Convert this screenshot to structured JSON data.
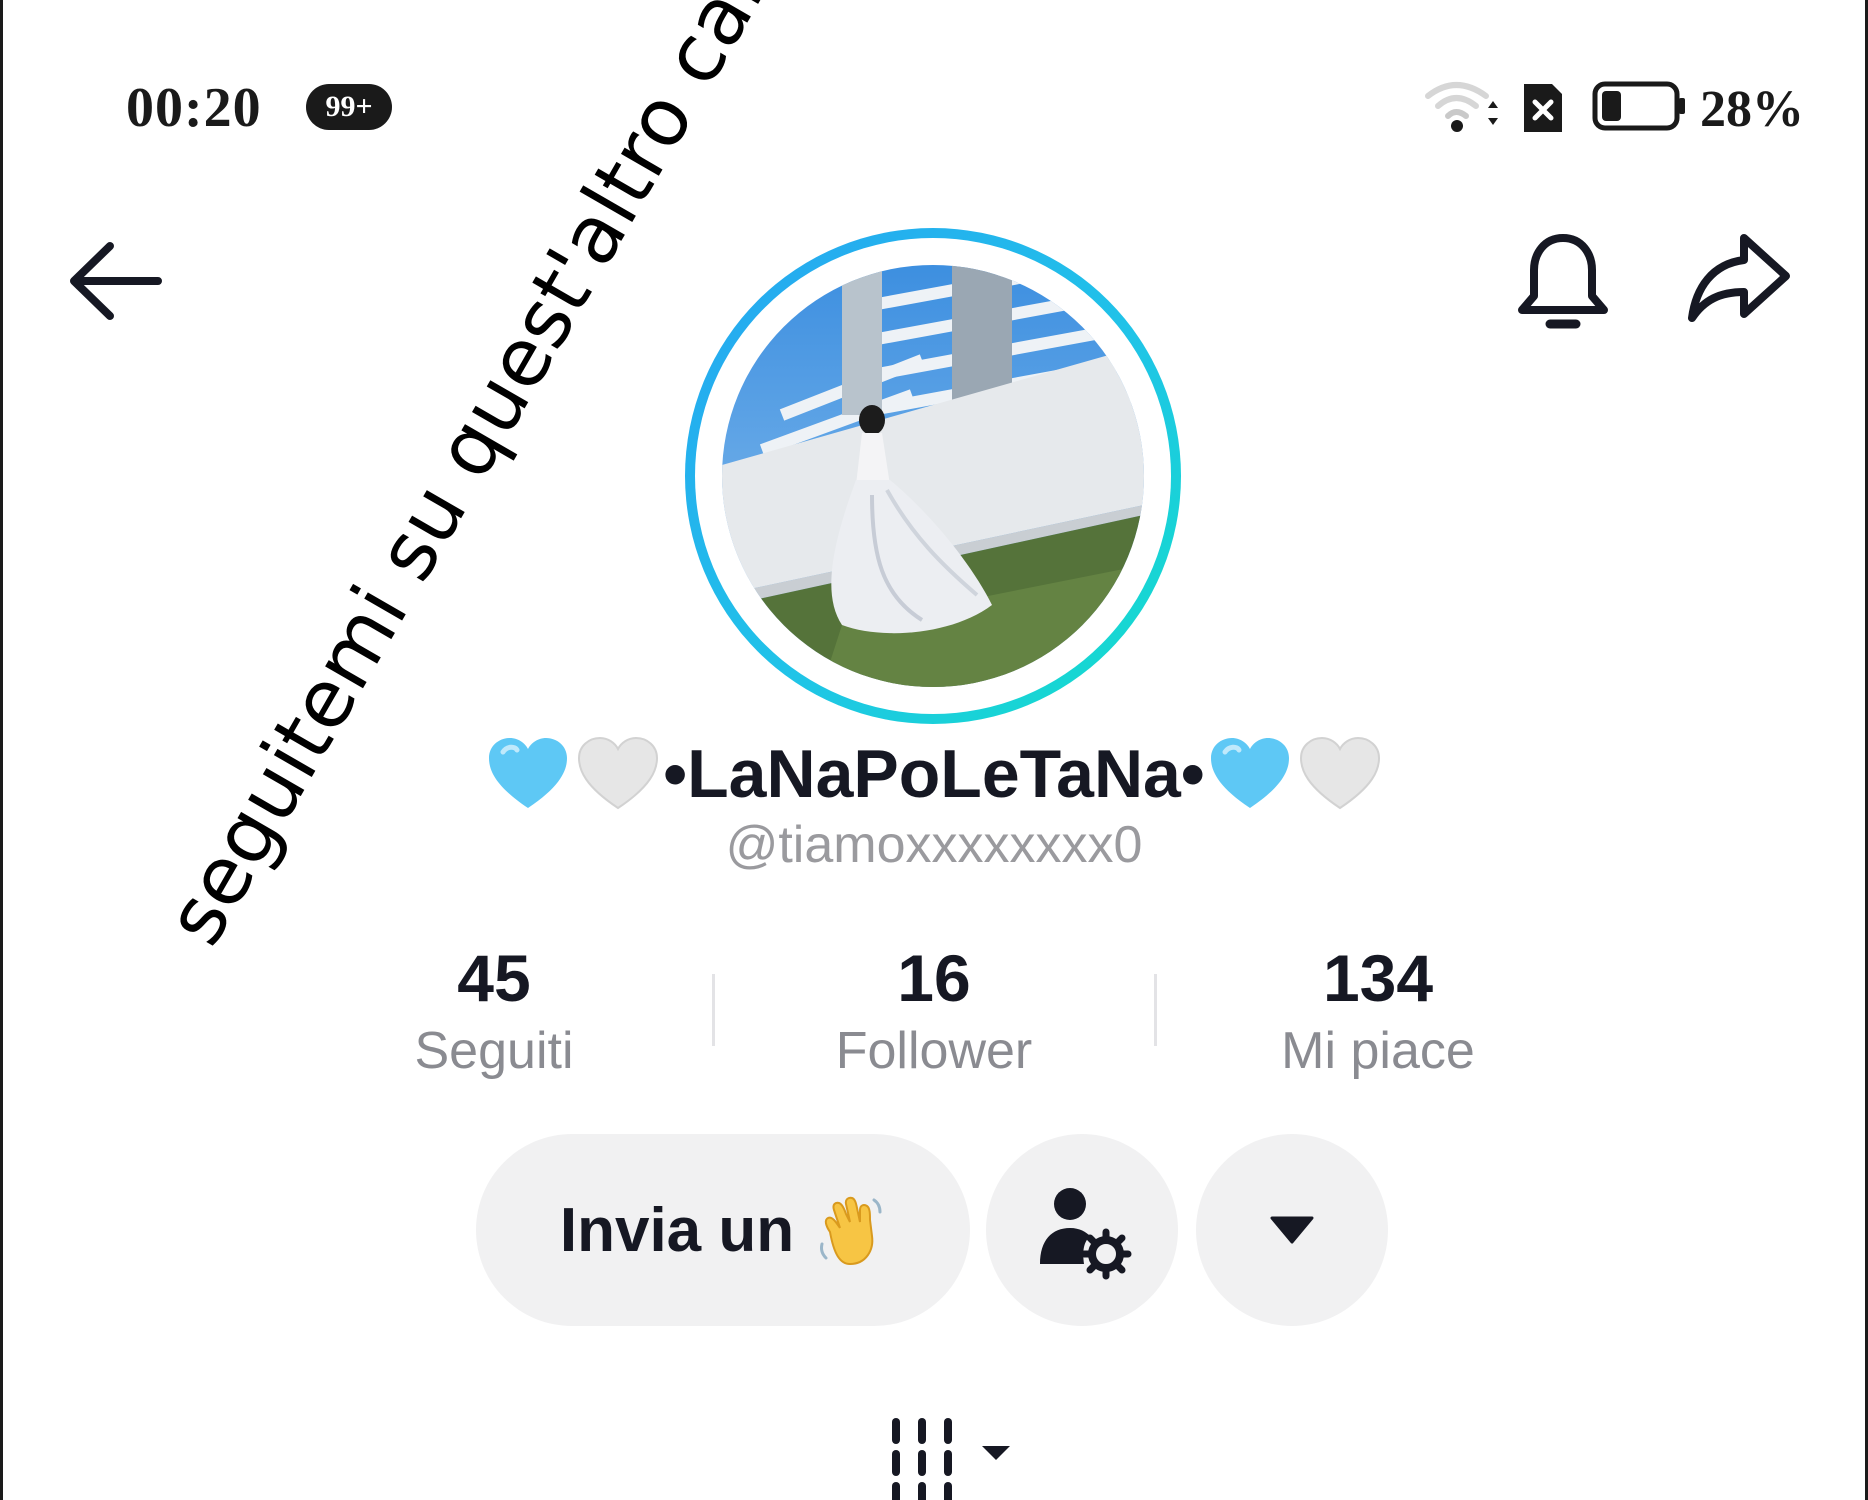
{
  "status_bar": {
    "time": "00:20",
    "notification_badge": "99+",
    "battery_percent": "28%",
    "battery_level": 0.28,
    "icons": [
      "wifi-icon",
      "sim-icon",
      "battery-icon"
    ]
  },
  "nav": {
    "icons": [
      "back-arrow-icon",
      "bell-icon",
      "share-icon"
    ]
  },
  "overlay": {
    "caption": "seguitemi su quest'altro canale"
  },
  "profile": {
    "display_name": "•LaNaPoLeTaNa•",
    "username": "@tiamoxxxxxxxx0",
    "ring_gradient": [
      "#27a4f2",
      "#12e0c8"
    ],
    "heart_colors": {
      "blue": "#5ec8f5",
      "white": "#e6e6e6"
    }
  },
  "stats": [
    {
      "value": "45",
      "label": "Seguiti"
    },
    {
      "value": "16",
      "label": "Follower"
    },
    {
      "value": "134",
      "label": "Mi piace"
    }
  ],
  "actions": {
    "wave_label": "Invia un",
    "wave_icon": "waving-hand-icon",
    "manage_icon": "person-settings-icon",
    "more_icon": "caret-down-icon"
  },
  "tabs": {
    "videos_icon": "grid-lines-icon"
  },
  "colors": {
    "text_primary": "#161823",
    "text_secondary": "#8a8b91",
    "button_bg": "#f1f1f2"
  }
}
